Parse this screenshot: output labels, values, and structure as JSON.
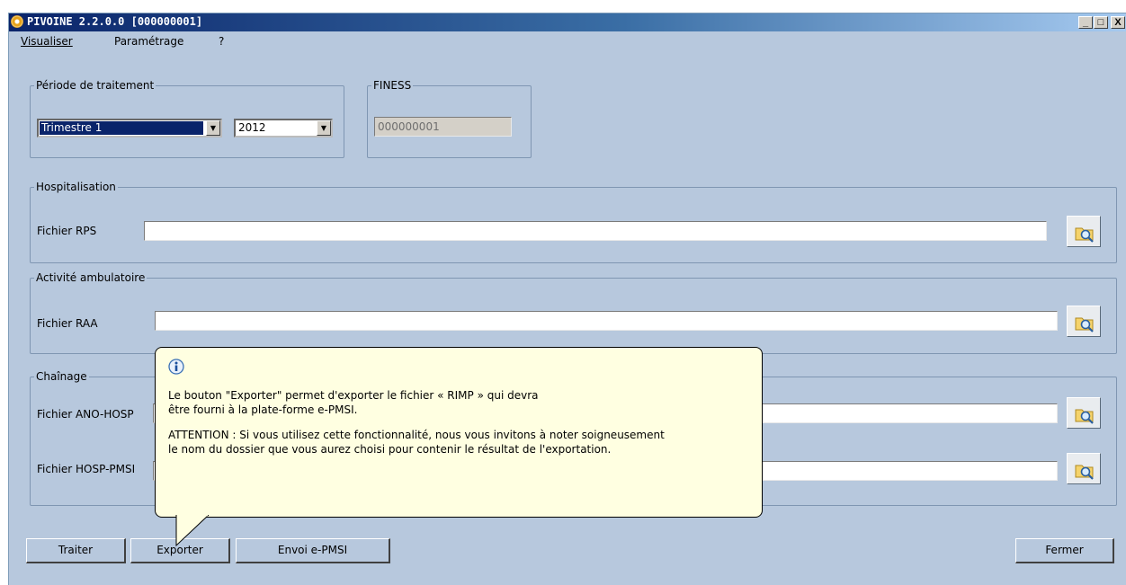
{
  "window": {
    "title": "PIVOINE 2.2.0.0 [000000001]",
    "minimize_glyph": "_",
    "maximize_glyph": "□",
    "close_glyph": "X"
  },
  "menu": {
    "visualiser": "Visualiser",
    "parametrage": "Paramétrage",
    "help": "?"
  },
  "periode": {
    "legend": "Période de traitement",
    "quarter": "Trimestre 1",
    "year": "2012"
  },
  "finess": {
    "legend": "FINESS",
    "value": "000000001"
  },
  "hospitalisation": {
    "legend": "Hospitalisation",
    "rps_label": "Fichier RPS",
    "rps_value": ""
  },
  "ambulatoire": {
    "legend": "Activité ambulatoire",
    "raa_label": "Fichier RAA",
    "raa_value": ""
  },
  "chainage": {
    "legend": "Chaînage",
    "ano_label": "Fichier ANO-HOSP",
    "ano_value": "",
    "hosp_label": "Fichier HOSP-PMSI",
    "hosp_value": ""
  },
  "tooltip": {
    "line1": "Le bouton \"Exporter\"  permet d'exporter le fichier « RIMP » qui devra",
    "line2": "être fourni à la plate-forme e-PMSI.",
    "line3": "ATTENTION : Si vous utilisez cette fonctionnalité, nous vous invitons à noter soigneusement",
    "line4": "le nom du dossier que vous aurez choisi pour contenir le résultat de l'exportation."
  },
  "buttons": {
    "traiter": "Traiter",
    "exporter": "Exporter",
    "envoi": "Envoi e-PMSI",
    "fermer": "Fermer"
  },
  "colors": {
    "background": "#b7c8dd",
    "title_bar_start": "#0a246a",
    "tooltip_background": "#ffffe1",
    "selection": "#0a246a"
  },
  "icons": {
    "app": "pivoine-flower-icon",
    "browse": "folder-magnifier-icon",
    "info": "info-icon"
  }
}
